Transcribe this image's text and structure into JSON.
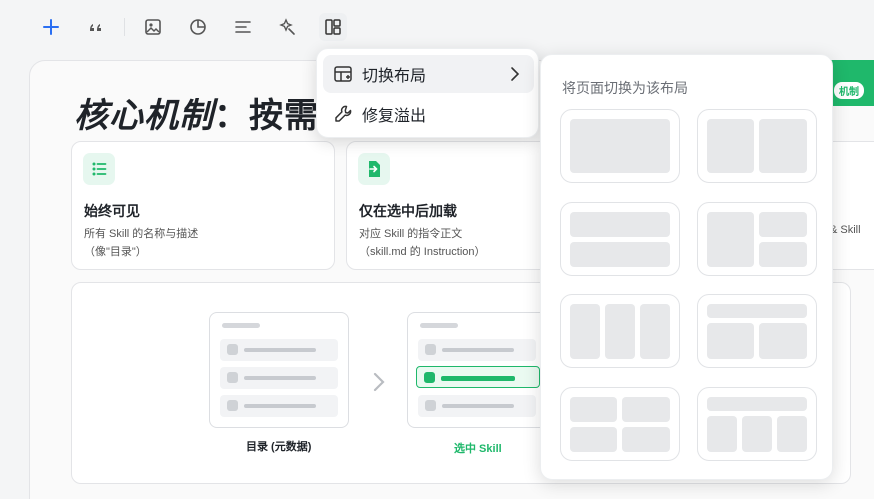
{
  "toolbar": {
    "items": [
      {
        "name": "add-icon"
      },
      {
        "name": "quote-icon"
      },
      {
        "name": "image-icon"
      },
      {
        "name": "chart-icon"
      },
      {
        "name": "text-align-icon"
      },
      {
        "name": "magic-icon"
      },
      {
        "name": "layout-icon"
      }
    ]
  },
  "slide": {
    "title_italic": "核心机制",
    "title_rest": "：按需加载",
    "chip_label": "机制",
    "cards": [
      {
        "title": "始终可见",
        "desc1": "所有 Skill 的名称与描述",
        "desc2": "（像\"目录\"）"
      },
      {
        "title": "仅在选中后加载",
        "desc1": "对应 Skill 的指令正文",
        "desc2": "（skill.md 的 Instruction）"
      }
    ],
    "card_fragment": "& Skill",
    "flow": {
      "left_label": "目录 (元数据)",
      "right_label": "选中 Skill"
    }
  },
  "menu": {
    "items": [
      {
        "label": "切换布局",
        "icon": "layout-switch-icon"
      },
      {
        "label": "修复溢出",
        "icon": "wrench-icon"
      }
    ]
  },
  "submenu": {
    "title": "将页面切换为该布局",
    "layouts": [
      "single-block",
      "two-columns",
      "two-rows",
      "left-block-right-stack",
      "three-columns",
      "header-two-columns",
      "two-by-two-grid",
      "header-three-columns"
    ]
  },
  "colors": {
    "accent_green": "#1fb86b",
    "toolbar_blue": "#2b6ff2"
  }
}
